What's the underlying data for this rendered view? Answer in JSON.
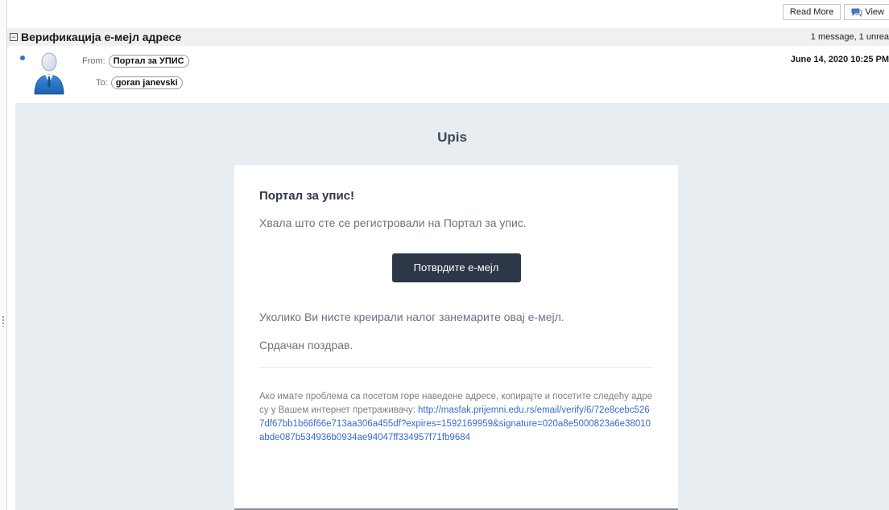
{
  "toolbar": {
    "read_more_label": "Read More",
    "view_label": "View"
  },
  "thread": {
    "title": "Верификација е-мејл адресе",
    "count": "1 message, 1 unrea"
  },
  "message": {
    "from_label": "From:",
    "from_name": "Портал за УПИС",
    "to_label": "To:",
    "to_name": "goran janevski",
    "date": "June 14, 2020 10:25 PM"
  },
  "email": {
    "brand": "Upis",
    "heading": "Портал за упис!",
    "intro": "Хвала што сте се регистровали на Портал за упис.",
    "button_label": "Потврдите е-мејл",
    "ignore_text": "Уколико Ви нисте креирали налог занемарите овај е-мејл.",
    "regards": "Срдачан поздрав.",
    "help_text": "Ако имате проблема са посетом горе наведене адресе, копирајте и посетите следећу адресу у Вашем интернет претраживачу: ",
    "verify_link": "http://masfak.prijemni.edu.rs/email/verify/6/72e8cebc5267df67bb1b66f66e713aa306a455df?expires=1592169959&signature=020a8e5000823a6e38010abde087b534936b0934ae94047ff334957f71fb9684"
  },
  "colors": {
    "email_background": "#e8edf2",
    "button": "#2d3748",
    "link": "#3869d4",
    "unread_dot": "#2b78c5"
  },
  "icons": {
    "collapse": "minus-box-icon",
    "view": "speech-bubble-icon",
    "avatar": "user-avatar-icon"
  }
}
